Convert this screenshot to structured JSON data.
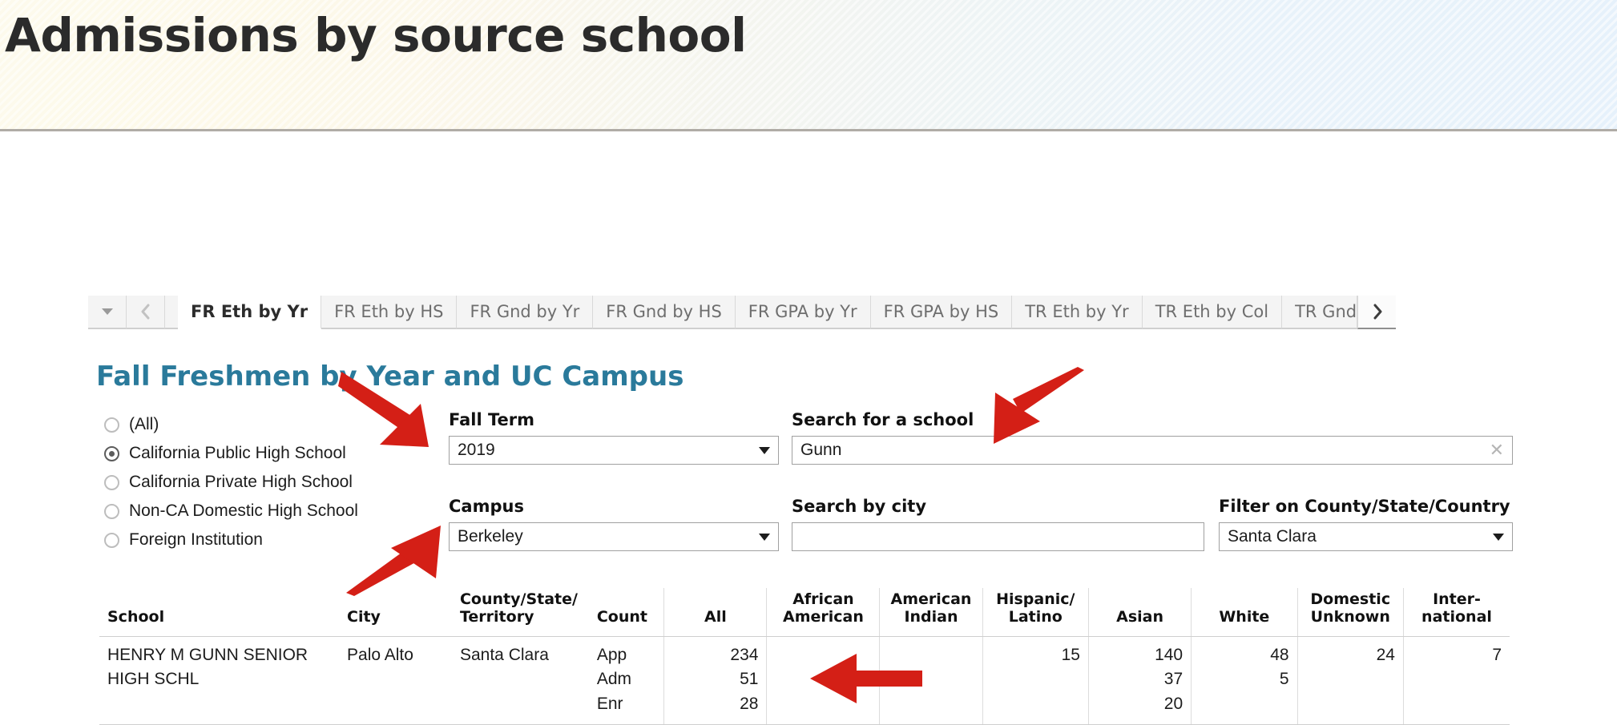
{
  "banner": {
    "title": "Admissions by source school"
  },
  "tabstrip": {
    "dropdown_icon": "chevron-down-icon",
    "prev_icon": "chevron-left-icon",
    "next_icon": "chevron-right-icon",
    "tabs": [
      {
        "label": "FR Eth by Yr",
        "active": true
      },
      {
        "label": "FR Eth by HS",
        "active": false
      },
      {
        "label": "FR Gnd by Yr",
        "active": false
      },
      {
        "label": "FR Gnd by HS",
        "active": false
      },
      {
        "label": "FR GPA by Yr",
        "active": false
      },
      {
        "label": "FR GPA by HS",
        "active": false
      },
      {
        "label": "TR Eth by Yr",
        "active": false
      },
      {
        "label": "TR Eth by Col",
        "active": false
      },
      {
        "label": "TR Gnd",
        "active": false
      }
    ]
  },
  "viz": {
    "title": "Fall Freshmen by Year and UC Campus",
    "title_color": "#2a7a9b"
  },
  "school_type_filter": {
    "options": [
      {
        "label": "(All)",
        "selected": false
      },
      {
        "label": "California Public High School",
        "selected": true
      },
      {
        "label": "California Private High School",
        "selected": false
      },
      {
        "label": "Non-CA Domestic High School",
        "selected": false
      },
      {
        "label": "Foreign Institution",
        "selected": false
      }
    ]
  },
  "controls": {
    "fall_term": {
      "label": "Fall Term",
      "value": "2019"
    },
    "campus": {
      "label": "Campus",
      "value": "Berkeley"
    },
    "search_school": {
      "label": "Search for a school",
      "value": "Gunn",
      "placeholder": "",
      "clear_icon": "close-icon"
    },
    "search_city": {
      "label": "Search by city",
      "value": "",
      "placeholder": ""
    },
    "county_filter": {
      "label": "Filter on County/State/Country",
      "value": "Santa Clara"
    }
  },
  "table": {
    "headers": [
      "School",
      "City",
      "County/State/\nTerritory",
      "Count",
      "All",
      "African\nAmerican",
      "American\nIndian",
      "Hispanic/\nLatino",
      "Asian",
      "White",
      "Domestic\nUnknown",
      "Inter-\nnational"
    ],
    "rows": [
      {
        "school": "HENRY M GUNN SENIOR HIGH SCHL",
        "city": "Palo Alto",
        "county": "Santa Clara",
        "count_labels": [
          "App",
          "Adm",
          "Enr"
        ],
        "all": [
          "234",
          "51",
          "28"
        ],
        "african_american": [
          "",
          "",
          ""
        ],
        "american_indian": [
          "",
          "",
          ""
        ],
        "hispanic_latino": [
          "15",
          "",
          ""
        ],
        "asian": [
          "140",
          "37",
          "20"
        ],
        "white": [
          "48",
          "5",
          ""
        ],
        "domestic_unknown": [
          "24",
          "",
          ""
        ],
        "international": [
          "7",
          "",
          ""
        ]
      }
    ]
  },
  "annotations": {
    "color": "#d41f16",
    "arrows": [
      {
        "name": "arrow-to-fall-term",
        "points_to": "Fall Term dropdown"
      },
      {
        "name": "arrow-to-search-school",
        "points_to": "Search for a school field"
      },
      {
        "name": "arrow-to-campus",
        "points_to": "Campus dropdown"
      },
      {
        "name": "arrow-to-all-count",
        "points_to": "All column count 234"
      }
    ]
  }
}
